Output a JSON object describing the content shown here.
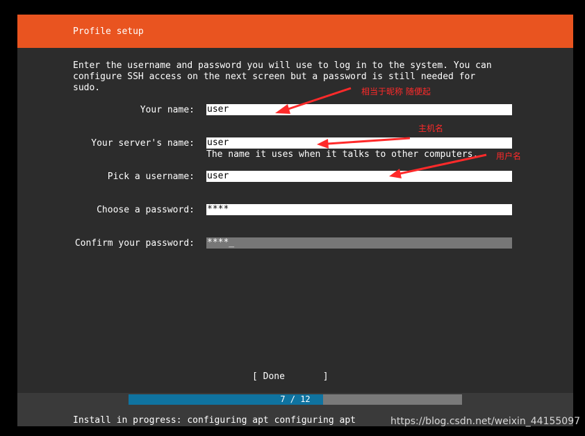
{
  "header": {
    "title": "Profile setup"
  },
  "intro": {
    "line1": "Enter the username and password you will use to log in to the system. You can",
    "line2": "configure SSH access on the next screen but a password is still needed for",
    "line3": "sudo."
  },
  "form": {
    "your_name_label": "Your name:",
    "your_name_value": "user",
    "server_name_label": "Your server's name:",
    "server_name_value": "user",
    "server_name_hint": "The name it uses when it talks to other computers.",
    "username_label": "Pick a username:",
    "username_value": "user",
    "password_label": "Choose a password:",
    "password_value": "****",
    "confirm_label": "Confirm your password:",
    "confirm_value": "****_"
  },
  "annotations": {
    "nickname": "相当于昵称 随便起",
    "hostname": "主机名",
    "username": "用户名",
    "color": "#ff2a2a"
  },
  "done_label": "[ Done       ]",
  "progress": {
    "text": "7 / 12",
    "current": 7,
    "total": 12
  },
  "status": "Install in progress: configuring apt configuring apt",
  "watermark": "https://blog.csdn.net/weixin_44155097",
  "colors": {
    "header": "#e95420",
    "progress_fill": "#0f73a0"
  }
}
